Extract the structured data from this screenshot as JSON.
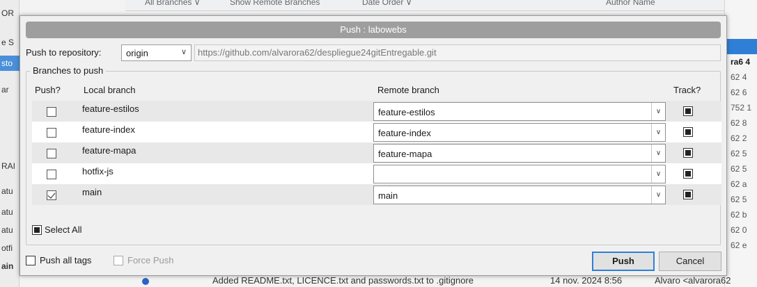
{
  "background": {
    "toolbar": [
      "All Branches ∨",
      "Show Remote Branches",
      "Date Order ∨",
      "Author Name"
    ],
    "left_items": [
      "OR",
      "e S",
      "sto",
      "ar",
      "RAI",
      "atu",
      "atu",
      "atu",
      "otfi",
      "ain"
    ],
    "right_items": [
      "ra6",
      "62",
      "62",
      "752",
      "62",
      "62",
      "62",
      "62",
      "62",
      "62",
      "62",
      "62",
      "62"
    ],
    "right_marks": [
      "4",
      "4",
      "6",
      "1",
      "8",
      "2",
      "5",
      "5",
      "a",
      "5",
      "b",
      "0",
      "e"
    ],
    "bottom_commit": "Added README.txt, LICENCE.txt and passwords.txt to .gitignore",
    "bottom_date": "14 nov. 2024 8:56",
    "bottom_author": "Alvaro <alvarora62"
  },
  "dialog": {
    "title": "Push : labowebs",
    "repo_label": "Push to repository:",
    "repo_value": "origin",
    "repo_url": "https://github.com/alvarora62/despliegue24gitEntregable.git",
    "group_title": "Branches to push",
    "columns": {
      "push": "Push?",
      "local": "Local branch",
      "remote": "Remote branch",
      "track": "Track?"
    },
    "branches": [
      {
        "local": "feature-estilos",
        "remote": "feature-estilos",
        "push": false,
        "track": true
      },
      {
        "local": "feature-index",
        "remote": "feature-index",
        "push": false,
        "track": true
      },
      {
        "local": "feature-mapa",
        "remote": "feature-mapa",
        "push": false,
        "track": true
      },
      {
        "local": "hotfix-js",
        "remote": "",
        "push": false,
        "track": true
      },
      {
        "local": "main",
        "remote": "main",
        "push": true,
        "track": true
      }
    ],
    "select_all": "Select All",
    "push_all_tags": "Push all tags",
    "force_push": "Force Push",
    "push_button": "Push",
    "cancel_button": "Cancel"
  }
}
